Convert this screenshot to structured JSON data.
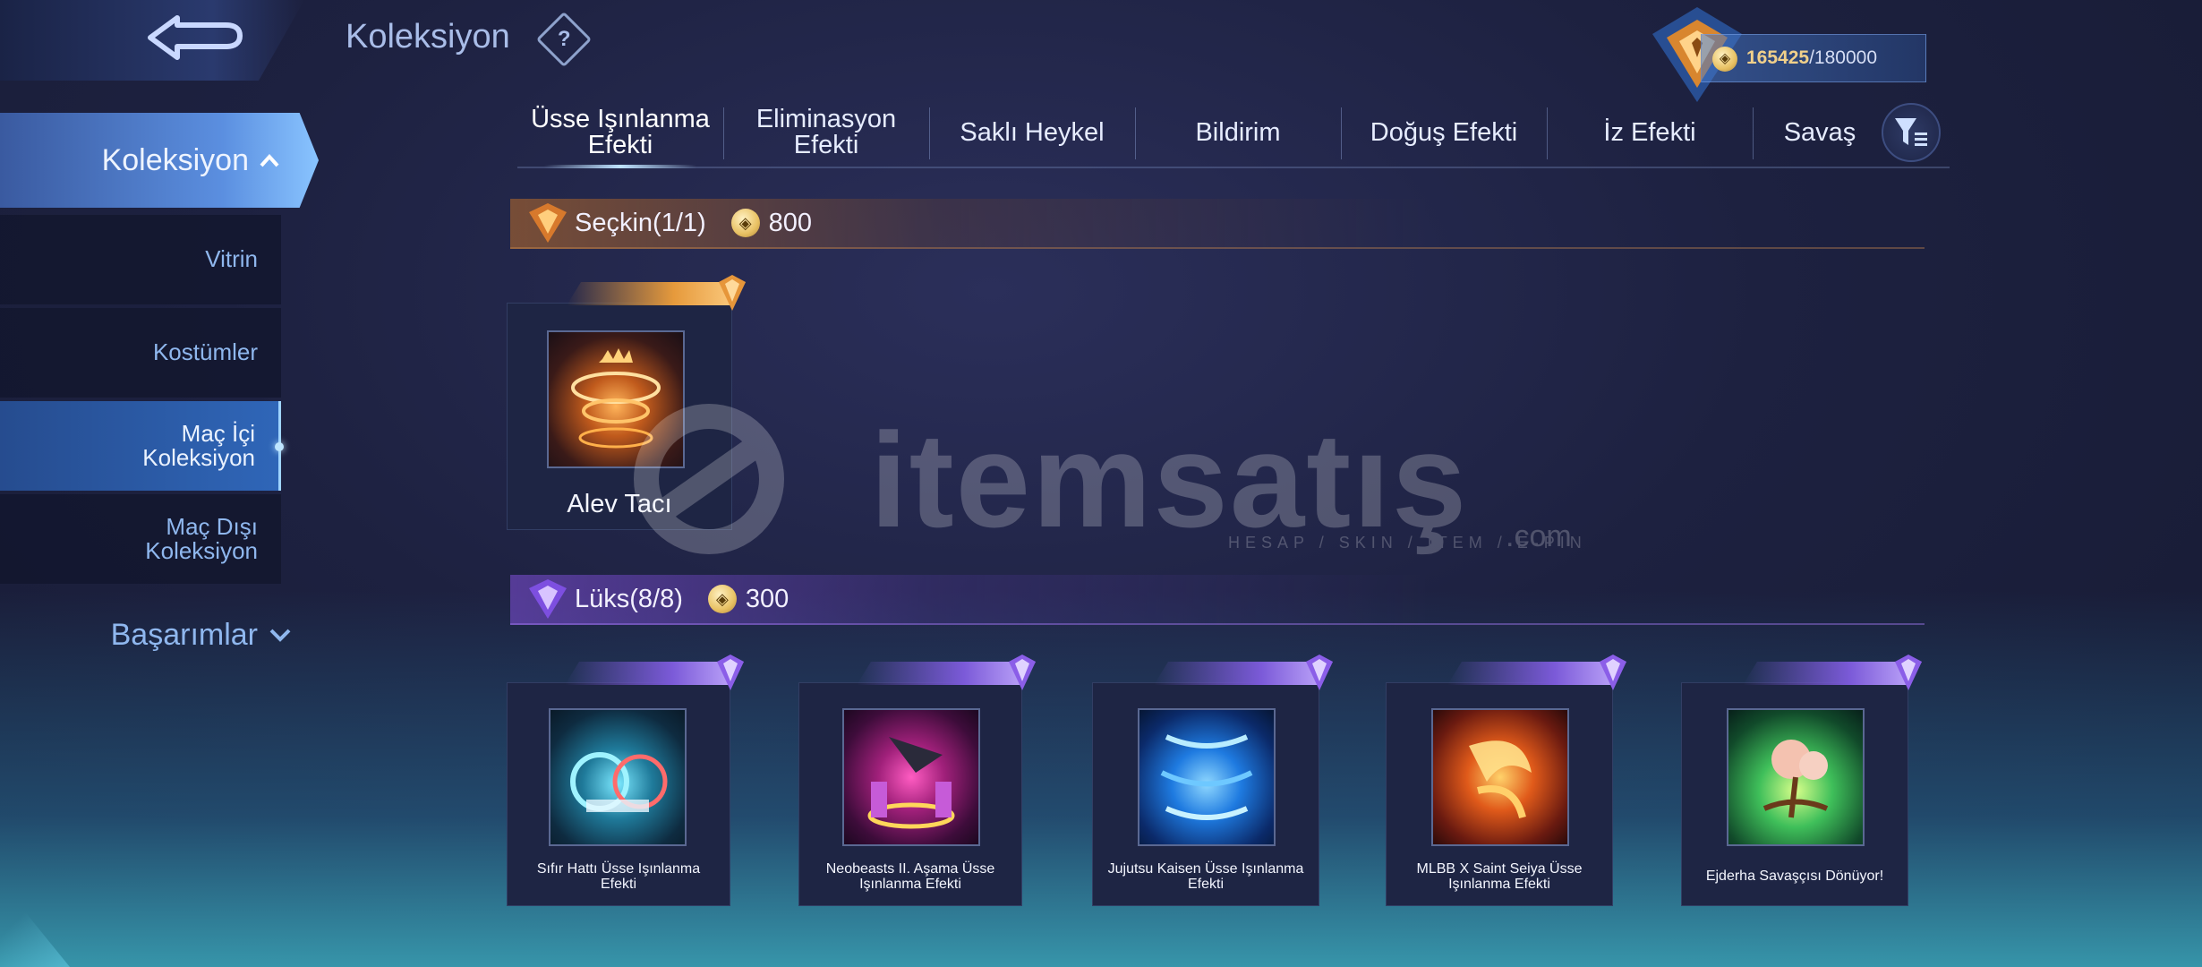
{
  "header": {
    "title": "Koleksiyon",
    "help_symbol": "?",
    "points_current": "165425",
    "points_separator": "/",
    "points_max": "180000"
  },
  "sidebar": {
    "main_label": "Koleksiyon",
    "items": [
      {
        "line1": "Vitrin",
        "line2": ""
      },
      {
        "line1": "Kostümler",
        "line2": ""
      },
      {
        "line1": "Maç İçi",
        "line2": "Koleksiyon"
      },
      {
        "line1": "Maç Dışı",
        "line2": "Koleksiyon"
      }
    ],
    "achievements_label": "Başarımlar"
  },
  "tabs": [
    {
      "line1": "Üsse Işınlanma",
      "line2": "Efekti"
    },
    {
      "line1": "Eliminasyon",
      "line2": "Efekti"
    },
    {
      "line1": "Saklı Heykel",
      "line2": ""
    },
    {
      "line1": "Bildirim",
      "line2": ""
    },
    {
      "line1": "Doğuş Efekti",
      "line2": ""
    },
    {
      "line1": "İz Efekti",
      "line2": ""
    },
    {
      "line1": "Savaş",
      "line2": ""
    }
  ],
  "sections": {
    "elite": {
      "label": "Seçkin(1/1)",
      "points": "800"
    },
    "luxury": {
      "label": "Lüks(8/8)",
      "points": "300"
    }
  },
  "elite_items": [
    {
      "name": "Alev Tacı"
    }
  ],
  "luxury_items": [
    {
      "name_line1": "Sıfır Hattı Üsse Işınlanma",
      "name_line2": "Efekti"
    },
    {
      "name_line1": "Neobeasts II. Aşama Üsse",
      "name_line2": "Işınlanma Efekti"
    },
    {
      "name_line1": "Jujutsu Kaisen Üsse Işınlanma",
      "name_line2": "Efekti"
    },
    {
      "name_line1": "MLBB X Saint Seiya Üsse",
      "name_line2": "Işınlanma Efekti"
    },
    {
      "name_line1": "Ejderha Savaşçısı Dönüyor!",
      "name_line2": ""
    }
  ],
  "watermark": {
    "text": "itemsatış",
    "sub": "HESAP / SKIN / ITEM / E-PIN",
    "domain": ".com"
  },
  "icons": {
    "back": "back-arrow-icon",
    "help": "question-diamond-icon",
    "filter": "filter-icon",
    "coin": "battle-point-coin-icon",
    "chevron_up": "chevron-up-icon",
    "chevron_down": "chevron-down-icon"
  },
  "colors": {
    "accent_gold": "#e8a84a",
    "accent_purple": "#8a63e6",
    "sidebar_active": "#5b8fe0",
    "coin": "#e8c163"
  }
}
